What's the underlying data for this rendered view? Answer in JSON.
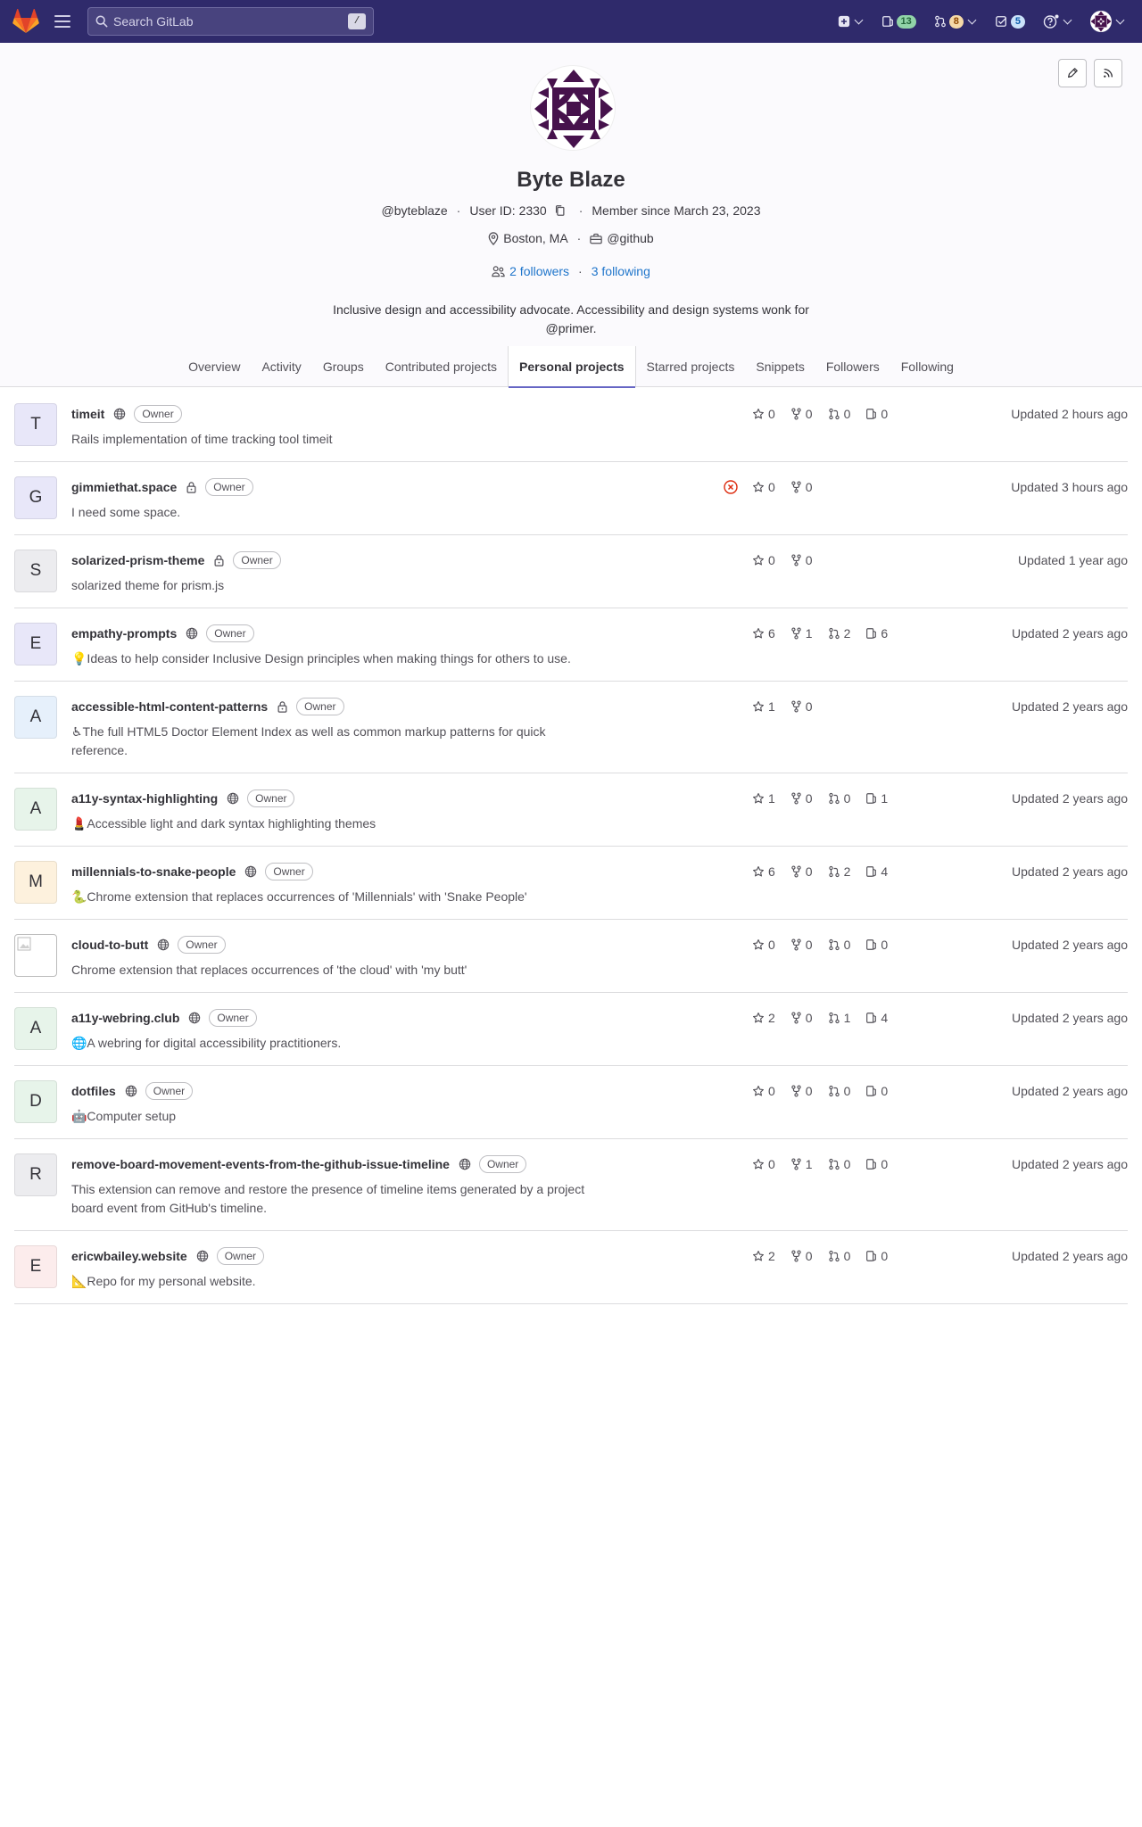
{
  "topbar": {
    "search_placeholder": "Search GitLab",
    "search_shortcut": "/",
    "issues_count": "13",
    "mrs_count": "8",
    "todos_count": "5"
  },
  "profile": {
    "name": "Byte Blaze",
    "username": "@byteblaze",
    "user_id": "User ID: 2330",
    "member_since": "Member since March 23, 2023",
    "location": "Boston, MA",
    "organization": "@github",
    "followers": "2 followers",
    "following": "3 following",
    "bio": "Inclusive design and accessibility advocate. Accessibility and design systems wonk for @primer."
  },
  "tabs": [
    "Overview",
    "Activity",
    "Groups",
    "Contributed projects",
    "Personal projects",
    "Starred projects",
    "Snippets",
    "Followers",
    "Following"
  ],
  "active_tab": "Personal projects",
  "colors": {
    "topbar": "#2f2a6b",
    "link": "#1f75cb",
    "active_tab_underline": "#6666c4",
    "ci_failed": "#dd2b0e"
  },
  "projects": [
    {
      "letter": "T",
      "avatar_bg": "#e8e7f9",
      "name": "timeit",
      "visibility": "public",
      "role": "Owner",
      "description": "Rails implementation of time tracking tool timeit",
      "stars": "0",
      "forks": "0",
      "mrs": "0",
      "issues": "0",
      "updated": "Updated 2 hours ago"
    },
    {
      "letter": "G",
      "avatar_bg": "#e8e7f9",
      "name": "gimmiethat.space",
      "visibility": "private",
      "role": "Owner",
      "description": "I need some space.",
      "stars": "0",
      "forks": "0",
      "mrs": null,
      "issues": null,
      "ci_failed": true,
      "updated": "Updated 3 hours ago"
    },
    {
      "letter": "S",
      "avatar_bg": "#ececef",
      "name": "solarized-prism-theme",
      "visibility": "private",
      "role": "Owner",
      "description": "solarized theme for prism.js",
      "stars": "0",
      "forks": "0",
      "mrs": null,
      "issues": null,
      "updated": "Updated 1 year ago"
    },
    {
      "letter": "E",
      "avatar_bg": "#e8e7f9",
      "name": "empathy-prompts",
      "visibility": "public",
      "role": "Owner",
      "description": "💡Ideas to help consider Inclusive Design principles when making things for others to use.",
      "stars": "6",
      "forks": "1",
      "mrs": "2",
      "issues": "6",
      "updated": "Updated 2 years ago"
    },
    {
      "letter": "A",
      "avatar_bg": "#e6f0fb",
      "name": "accessible-html-content-patterns",
      "visibility": "private",
      "role": "Owner",
      "description": "♿The full HTML5 Doctor Element Index as well as common markup patterns for quick reference.",
      "stars": "1",
      "forks": "0",
      "mrs": null,
      "issues": null,
      "updated": "Updated 2 years ago"
    },
    {
      "letter": "A",
      "avatar_bg": "#e7f4ea",
      "name": "a11y-syntax-highlighting",
      "visibility": "public",
      "role": "Owner",
      "description": "💄Accessible light and dark syntax highlighting themes",
      "stars": "1",
      "forks": "0",
      "mrs": "0",
      "issues": "1",
      "updated": "Updated 2 years ago"
    },
    {
      "letter": "M",
      "avatar_bg": "#fdf1dd",
      "name": "millennials-to-snake-people",
      "visibility": "public",
      "role": "Owner",
      "description": "🐍Chrome extension that replaces occurrences of 'Millennials' with 'Snake People'",
      "stars": "6",
      "forks": "0",
      "mrs": "2",
      "issues": "4",
      "updated": "Updated 2 years ago"
    },
    {
      "letter": "",
      "avatar_bg": "#ffffff",
      "avatar_image": true,
      "name": "cloud-to-butt",
      "visibility": "public",
      "role": "Owner",
      "description": "Chrome extension that replaces occurrences of 'the cloud' with 'my butt'",
      "stars": "0",
      "forks": "0",
      "mrs": "0",
      "issues": "0",
      "updated": "Updated 2 years ago"
    },
    {
      "letter": "A",
      "avatar_bg": "#e7f4ea",
      "name": "a11y-webring.club",
      "visibility": "public",
      "role": "Owner",
      "description": "🌐A webring for digital accessibility practitioners.",
      "stars": "2",
      "forks": "0",
      "mrs": "1",
      "issues": "4",
      "updated": "Updated 2 years ago"
    },
    {
      "letter": "D",
      "avatar_bg": "#e7f4ea",
      "name": "dotfiles",
      "visibility": "public",
      "role": "Owner",
      "description": "🤖Computer setup",
      "stars": "0",
      "forks": "0",
      "mrs": "0",
      "issues": "0",
      "updated": "Updated 2 years ago"
    },
    {
      "letter": "R",
      "avatar_bg": "#ececef",
      "name": "remove-board-movement-events-from-the-github-issue-timeline",
      "visibility": "public",
      "role": "Owner",
      "description": "This extension can remove and restore the presence of timeline items generated by a project board event from GitHub's timeline.",
      "stars": "0",
      "forks": "1",
      "mrs": "0",
      "issues": "0",
      "updated": "Updated 2 years ago"
    },
    {
      "letter": "E",
      "avatar_bg": "#fcecec",
      "name": "ericwbailey.website",
      "visibility": "public",
      "role": "Owner",
      "description": "📐Repo for my personal website.",
      "stars": "2",
      "forks": "0",
      "mrs": "0",
      "issues": "0",
      "updated": "Updated 2 years ago"
    }
  ]
}
